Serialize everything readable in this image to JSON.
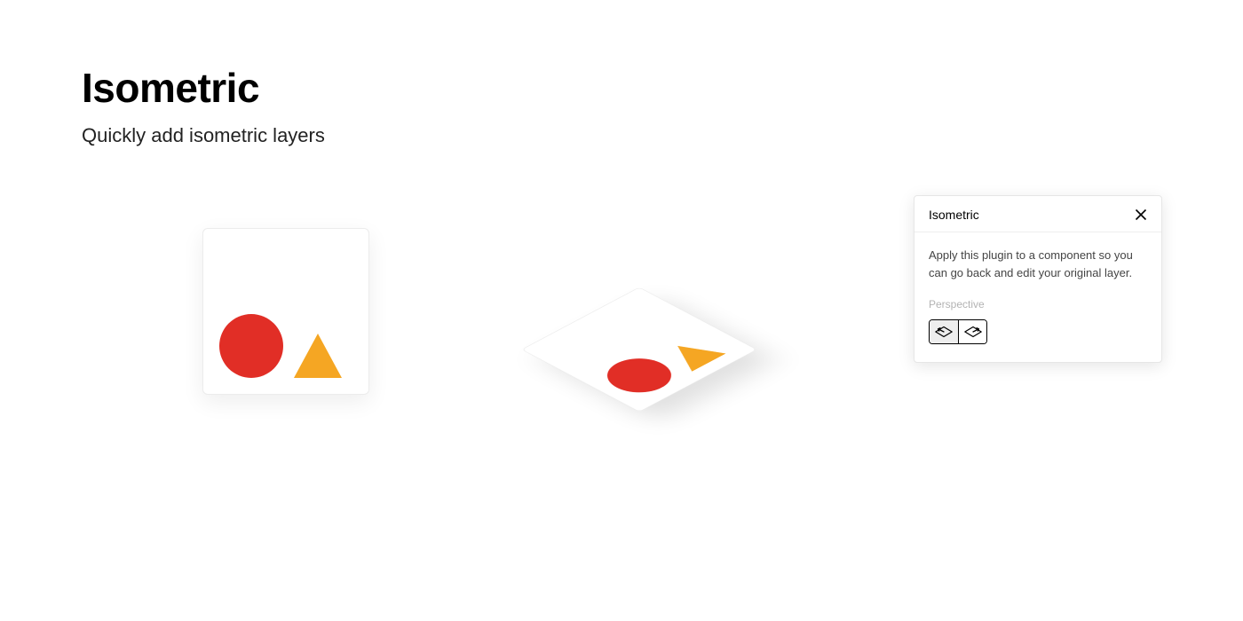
{
  "heading": {
    "title": "Isometric",
    "subtitle": "Quickly add isometric layers"
  },
  "panel": {
    "title": "Isometric",
    "description": "Apply this plugin to a component so you can go back and edit your original layer.",
    "section_label": "Perspective"
  }
}
